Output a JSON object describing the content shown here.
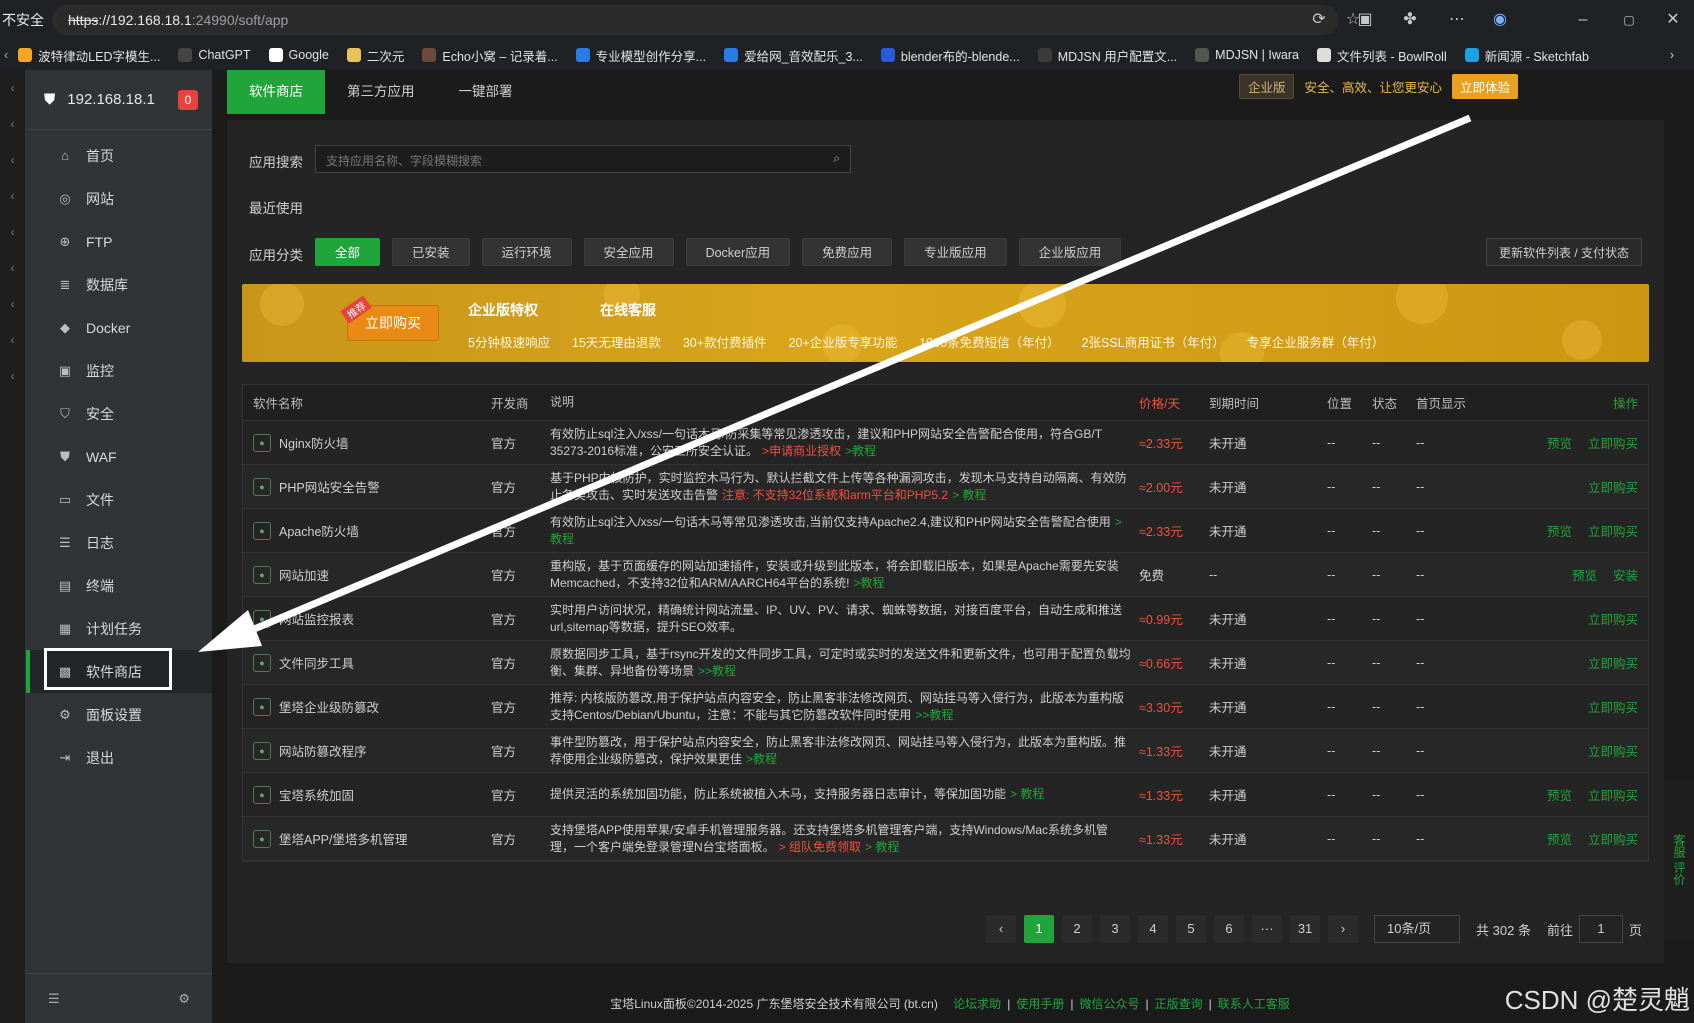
{
  "browser": {
    "insecure": "不安全",
    "url_scheme": "https",
    "url_host": "://192.168.18.1",
    "url_rest": ":24990/soft/app",
    "bookmarks": [
      {
        "label": "波特律动LED字模生...",
        "icon": "bolt-icon",
        "color": "#f5a623"
      },
      {
        "label": "ChatGPT",
        "icon": "chatgpt-icon",
        "color": "#444"
      },
      {
        "label": "Google",
        "icon": "google-icon",
        "color": "#fff"
      },
      {
        "label": "二次元",
        "icon": "folder-icon",
        "color": "#e6c35a"
      },
      {
        "label": "Echo小窝 – 记录着...",
        "icon": "echo-icon",
        "color": "#6b4a3a"
      },
      {
        "label": "专业模型创作分享...",
        "icon": "model-icon",
        "color": "#2a7be4"
      },
      {
        "label": "爱给网_音效配乐_3...",
        "icon": "aigei-icon",
        "color": "#2a7be4"
      },
      {
        "label": "blender布的-blende...",
        "icon": "bilibili-icon",
        "color": "#2a5bd7"
      },
      {
        "label": "MDJSN 用户配置文...",
        "icon": "mdjsn-icon",
        "color": "#3a3a3a"
      },
      {
        "label": "MDJSN | Iwara",
        "icon": "iwara-icon",
        "color": "#555"
      },
      {
        "label": "文件列表 - BowlRoll",
        "icon": "bowlroll-icon",
        "color": "#ddd"
      },
      {
        "label": "新闻源 - Sketchfab",
        "icon": "sketchfab-icon",
        "color": "#1ca0e3"
      }
    ]
  },
  "sidebar": {
    "host": "192.168.18.1",
    "badge": "0",
    "items": [
      {
        "label": "首页",
        "icon": "home-icon",
        "glyph": "⌂"
      },
      {
        "label": "网站",
        "icon": "globe-icon",
        "glyph": "◎"
      },
      {
        "label": "FTP",
        "icon": "ftp-icon",
        "glyph": "⊕"
      },
      {
        "label": "数据库",
        "icon": "database-icon",
        "glyph": "≣"
      },
      {
        "label": "Docker",
        "icon": "docker-icon",
        "glyph": "◆"
      },
      {
        "label": "监控",
        "icon": "monitor-icon",
        "glyph": "▣"
      },
      {
        "label": "安全",
        "icon": "shield-icon",
        "glyph": "⛉"
      },
      {
        "label": "WAF",
        "icon": "waf-icon",
        "glyph": "⛊"
      },
      {
        "label": "文件",
        "icon": "folder-icon",
        "glyph": "▭"
      },
      {
        "label": "日志",
        "icon": "log-icon",
        "glyph": "☰"
      },
      {
        "label": "终端",
        "icon": "terminal-icon",
        "glyph": "▤"
      },
      {
        "label": "计划任务",
        "icon": "calendar-icon",
        "glyph": "▦"
      },
      {
        "label": "软件商店",
        "icon": "grid-icon",
        "glyph": "▩"
      },
      {
        "label": "面板设置",
        "icon": "settings-icon",
        "glyph": "⚙"
      },
      {
        "label": "退出",
        "icon": "logout-icon",
        "glyph": "⇥"
      }
    ],
    "active_index": 12
  },
  "tabs": [
    "软件商店",
    "第三方应用",
    "一键部署"
  ],
  "promo": {
    "ent": "企业版",
    "slogan": "安全、高效、让您更安心",
    "trial": "立即体验"
  },
  "search": {
    "label": "应用搜索",
    "placeholder": "支持应用名称、字段模糊搜索"
  },
  "recent_label": "最近使用",
  "category_label": "应用分类",
  "categories": [
    "全部",
    "已安装",
    "运行环境",
    "安全应用",
    "Docker应用",
    "免费应用",
    "专业版应用",
    "企业版应用"
  ],
  "update_btn": "更新软件列表 / 支付状态",
  "banner": {
    "buy": "立即购买",
    "hot": "推荐",
    "title": "企业版特权",
    "service": "在线客服",
    "features": [
      "5分钟极速响应",
      "15天无理由退款",
      "30+款付费插件",
      "20+企业版专享功能",
      "1000条免费短信（年付）",
      "2张SSL商用证书（年付）",
      "专享企业服务群（年付）"
    ]
  },
  "table": {
    "headers": [
      "软件名称",
      "开发商",
      "说明",
      "价格/天",
      "到期时间",
      "位置",
      "状态",
      "首页显示",
      "操作"
    ],
    "rows": [
      {
        "name": "Nginx防火墙",
        "dev": "官方",
        "desc": "有效防止sql注入/xss/一句话木马/防采集等常见渗透攻击，建议和PHP网站安全告警配合使用，符合GB/T 35273-2016标准，公安三所安全认证。",
        "link1": ">教程",
        "link2": ">申请商业授权",
        "price": "≈2.33元",
        "exp": "未开通",
        "pos": "--",
        "st": "--",
        "home": "--",
        "op1": "预览",
        "op2": "立即购买"
      },
      {
        "name": "PHP网站安全告警",
        "dev": "官方",
        "desc": "基于PHP内核防护，实时监控木马行为、默认拦截文件上传等各种漏洞攻击，发现木马支持自动隔离、有效防止各类攻击、实时发送攻击告警",
        "link1": "> 教程",
        "link2": "注意: 不支持32位系统和arm平台和PHP5.2",
        "price": "≈2.00元",
        "exp": "未开通",
        "pos": "--",
        "st": "--",
        "home": "--",
        "op1": "",
        "op2": "立即购买"
      },
      {
        "name": "Apache防火墙",
        "dev": "官方",
        "desc": "有效防止sql注入/xss/一句话木马等常见渗透攻击,当前仅支持Apache2.4,建议和PHP网站安全告警配合使用",
        "link1": ">教程",
        "link2": "",
        "price": "≈2.33元",
        "exp": "未开通",
        "pos": "--",
        "st": "--",
        "home": "--",
        "op1": "预览",
        "op2": "立即购买"
      },
      {
        "name": "网站加速",
        "dev": "官方",
        "desc": "重构版，基于页面缓存的网站加速插件，安装或升级到此版本，将会卸载旧版本，如果是Apache需要先安装Memcached，不支持32位和ARM/AARCH64平台的系统!",
        "link1": ">教程",
        "link2": "",
        "price": "免费",
        "exp": "--",
        "pos": "--",
        "st": "--",
        "home": "--",
        "op1": "预览",
        "op2": "安装"
      },
      {
        "name": "网站监控报表",
        "dev": "官方",
        "desc": "实时用户访问状况，精确统计网站流量、IP、UV、PV、请求、蜘蛛等数据，对接百度平台，自动生成和推送url,sitemap等数据，提升SEO效率。",
        "link1": "",
        "link2": "",
        "price": "≈0.99元",
        "exp": "未开通",
        "pos": "--",
        "st": "--",
        "home": "--",
        "op1": "",
        "op2": "立即购买"
      },
      {
        "name": "文件同步工具",
        "dev": "官方",
        "desc": "原数据同步工具，基于rsync开发的文件同步工具，可定时或实时的发送文件和更新文件，也可用于配置负载均衡、集群、异地备份等场景",
        "link1": ">>教程",
        "link2": "",
        "price": "≈0.66元",
        "exp": "未开通",
        "pos": "--",
        "st": "--",
        "home": "--",
        "op1": "",
        "op2": "立即购买"
      },
      {
        "name": "堡塔企业级防篡改",
        "dev": "官方",
        "desc": "推荐: 内核版防篡改,用于保护站点内容安全，防止黑客非法修改网页、网站挂马等入侵行为，此版本为重构版支持Centos/Debian/Ubuntu，注意：不能与其它防篡改软件同时使用",
        "link1": ">>教程",
        "link2": "",
        "price": "≈3.30元",
        "exp": "未开通",
        "pos": "--",
        "st": "--",
        "home": "--",
        "op1": "",
        "op2": "立即购买"
      },
      {
        "name": "网站防篡改程序",
        "dev": "官方",
        "desc": "事件型防篡改，用于保护站点内容安全，防止黑客非法修改网页、网站挂马等入侵行为，此版本为重构版。推荐使用企业级防篡改，保护效果更佳",
        "link1": ">教程",
        "link2": "",
        "price": "≈1.33元",
        "exp": "未开通",
        "pos": "--",
        "st": "--",
        "home": "--",
        "op1": "",
        "op2": "立即购买"
      },
      {
        "name": "宝塔系统加固",
        "dev": "官方",
        "desc": "提供灵活的系统加固功能，防止系统被植入木马，支持服务器日志审计，等保加固功能",
        "link1": "> 教程",
        "link2": "",
        "price": "≈1.33元",
        "exp": "未开通",
        "pos": "--",
        "st": "--",
        "home": "--",
        "op1": "预览",
        "op2": "立即购买"
      },
      {
        "name": "堡塔APP/堡塔多机管理",
        "dev": "官方",
        "desc": "支持堡塔APP使用苹果/安卓手机管理服务器。还支持堡塔多机管理客户端，支持Windows/Mac系统多机管理，一个客户端免登录管理N台宝塔面板。",
        "link1": "> 教程",
        "link2": "> 组队免费领取",
        "price": "≈1.33元",
        "exp": "未开通",
        "pos": "--",
        "st": "--",
        "home": "--",
        "op1": "预览",
        "op2": "立即购买"
      }
    ]
  },
  "pager": {
    "pages": [
      "1",
      "2",
      "3",
      "4",
      "5",
      "6",
      "···",
      "31"
    ],
    "active": "1",
    "size": "10条/页",
    "total": "共 302 条",
    "goto_label": "前往",
    "goto_value": "1",
    "page_unit": "页"
  },
  "footer": {
    "copy": "宝塔Linux面板©2014-2025 广东堡塔安全技术有限公司 (bt.cn)",
    "links": [
      "论坛求助",
      "使用手册",
      "微信公众号",
      "正版查询",
      "联系人工客服"
    ]
  },
  "watermark": "CSDN @楚灵魈",
  "float": "客服  评价"
}
